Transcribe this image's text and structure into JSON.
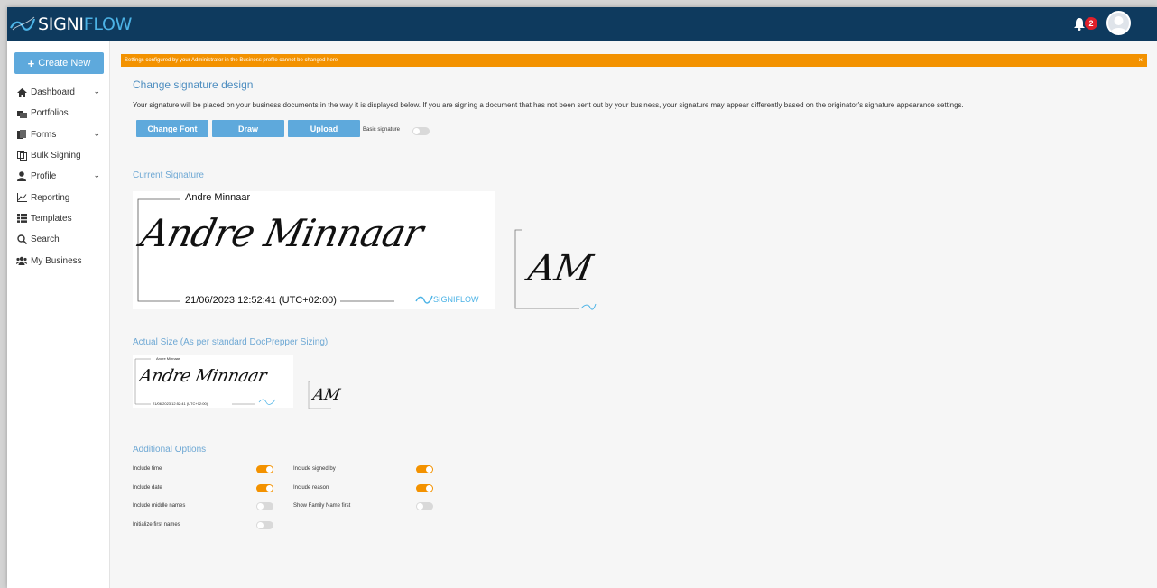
{
  "app": {
    "logo_text_a": "SIGNI",
    "logo_text_b": "FLOW",
    "notification_count": "2",
    "colors": {
      "topbar": "#0e3a5e",
      "accent": "#5ea9dc",
      "warning": "#f39200",
      "heading": "#4e8ec0",
      "badge": "#e0202a"
    }
  },
  "sidebar": {
    "create_label": "Create New",
    "items": [
      {
        "label": "Dashboard",
        "icon": "home-icon",
        "has_chevron": true
      },
      {
        "label": "Portfolios",
        "icon": "portfolio-icon",
        "has_chevron": false
      },
      {
        "label": "Forms",
        "icon": "forms-icon",
        "has_chevron": true
      },
      {
        "label": "Bulk Signing",
        "icon": "bulk-signing-icon",
        "has_chevron": false
      },
      {
        "label": "Profile",
        "icon": "user-icon",
        "has_chevron": true
      },
      {
        "label": "Reporting",
        "icon": "chart-icon",
        "has_chevron": false
      },
      {
        "label": "Templates",
        "icon": "list-icon",
        "has_chevron": false
      },
      {
        "label": "Search",
        "icon": "search-icon",
        "has_chevron": false
      },
      {
        "label": "My Business",
        "icon": "users-icon",
        "has_chevron": false
      }
    ]
  },
  "notice": {
    "text": "Settings configured by your Administrator in the Business profile cannot be changed here",
    "close": "×"
  },
  "main": {
    "title": "Change signature design",
    "description": "Your signature will be placed on your business documents in the way it is displayed below. If you are signing a document that has not been sent out by your business, your signature may appear differently based on the originator's signature appearance settings.",
    "buttons": {
      "change_font": "Change Font",
      "draw": "Draw",
      "upload": "Upload"
    },
    "basic_signature_label": "Basic signature",
    "basic_signature_on": false
  },
  "current_signature": {
    "heading": "Current Signature",
    "signed_by": "Andre Minnaar",
    "signature_script": "Andre Minnaar",
    "timestamp": "21/06/2023 12:52:41 (UTC+02:00)",
    "watermark_a": "SIGNI",
    "watermark_b": "FLOW",
    "initials": "AM"
  },
  "actual_size": {
    "heading": "Actual Size (As per standard DocPrepper Sizing)",
    "signed_by": "Andre Minnaar",
    "timestamp": "21/06/2023 12:52:41 (UTC+02:00)"
  },
  "options": {
    "heading": "Additional Options",
    "items": [
      {
        "label": "Include time",
        "on": true
      },
      {
        "label": "Include date",
        "on": true
      },
      {
        "label": "Include middle names",
        "on": false
      },
      {
        "label": "Initialize first names",
        "on": false
      },
      {
        "label": "Include signed by",
        "on": true
      },
      {
        "label": "Include reason",
        "on": true
      },
      {
        "label": "Show Family Name first",
        "on": false
      }
    ]
  }
}
